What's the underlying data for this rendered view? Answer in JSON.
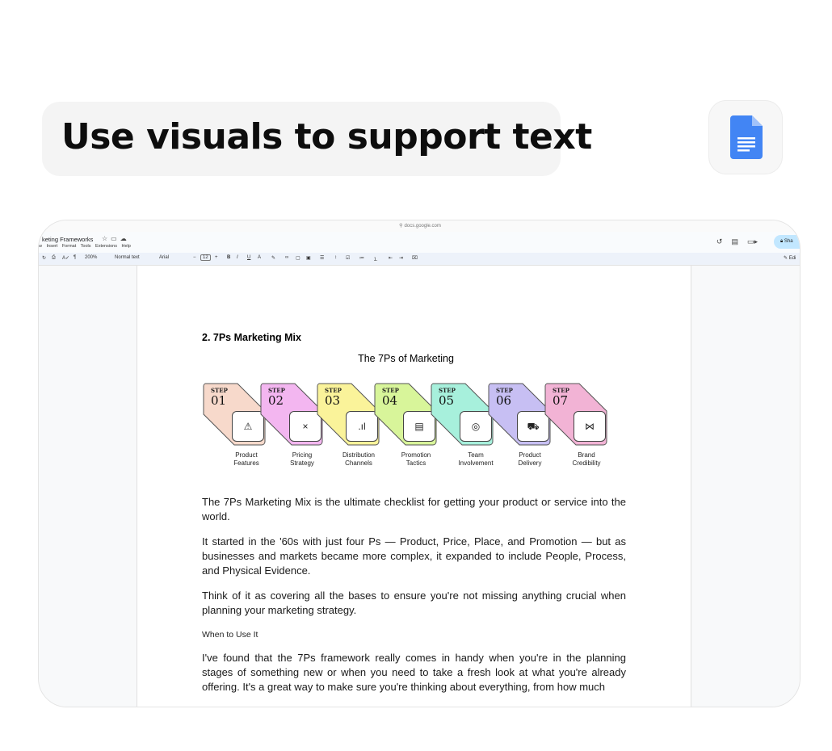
{
  "headline": "Use visuals to support text",
  "icons": {
    "app_badge": "google-docs-icon"
  },
  "browser": {
    "url": "docs.google.com",
    "doc_title": "keting Frameworks",
    "menus": [
      "w",
      "Insert",
      "Format",
      "Tools",
      "Extensions",
      "Help"
    ],
    "share_label": "Sha",
    "edit_label": "Edi",
    "toolbar": {
      "zoom": "200%",
      "style": "Normal text",
      "font": "Arial",
      "size": "12"
    }
  },
  "document": {
    "heading": "2. 7Ps Marketing Mix",
    "diagram_title": "The 7Ps of Marketing",
    "step_word": "STEP",
    "steps": [
      {
        "num": "01",
        "label1": "Product",
        "label2": "Features",
        "color": "#f7d9cb",
        "icon": "⚠"
      },
      {
        "num": "02",
        "label1": "Pricing",
        "label2": "Strategy",
        "color": "#f3b6f0",
        "icon": "×"
      },
      {
        "num": "03",
        "label1": "Distribution",
        "label2": "Channels",
        "color": "#faf39a",
        "icon": ".ıl"
      },
      {
        "num": "04",
        "label1": "Promotion",
        "label2": "Tactics",
        "color": "#d8f59a",
        "icon": "▤"
      },
      {
        "num": "05",
        "label1": "Team",
        "label2": "Involvement",
        "color": "#a7f0dc",
        "icon": "◎"
      },
      {
        "num": "06",
        "label1": "Product",
        "label2": "Delivery",
        "color": "#c7bff3",
        "icon": "⛟"
      },
      {
        "num": "07",
        "label1": "Brand",
        "label2": "Credibility",
        "color": "#f2b3d5",
        "icon": "⋈"
      }
    ],
    "para1": "The 7Ps Marketing Mix is the ultimate checklist for getting your product or service into the world.",
    "para2": "It started in the '60s with just four Ps — Product, Price, Place, and Promotion — but as businesses and markets became more complex, it expanded to include People, Process, and Physical Evidence.",
    "para3": "Think of it as covering all the bases to ensure you're not missing anything crucial when planning your marketing strategy.",
    "subheading": "When to Use It",
    "para4": "I've found that the 7Ps framework really comes in handy when you're in the planning stages of something new or when you need to take a fresh look at what you're already offering. It's a great way to make sure you're thinking about everything, from how much"
  }
}
